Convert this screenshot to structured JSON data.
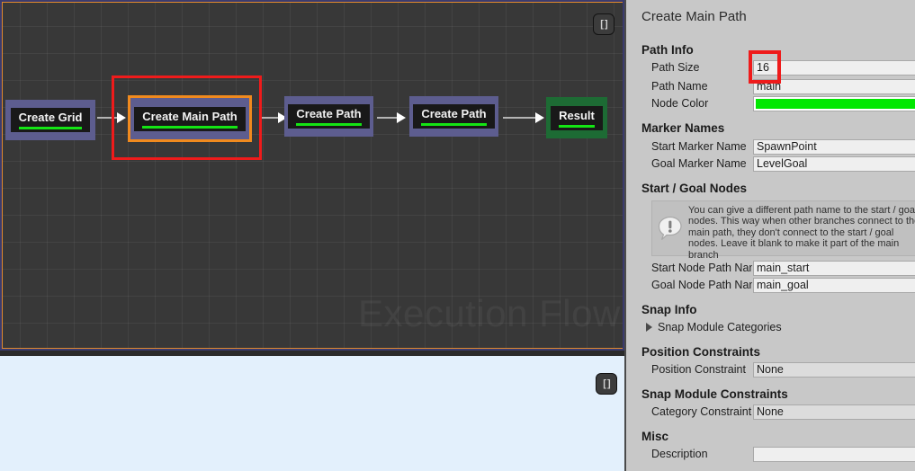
{
  "graph": {
    "watermark": "Execution Flow",
    "expand_button_icon": "brackets-icon",
    "nodes": [
      {
        "label": "Create Grid",
        "type": "node",
        "accent_color": "#14e514"
      },
      {
        "label": "Create Main Path",
        "type": "selected",
        "accent_color": "#14e514"
      },
      {
        "label": "Create Path",
        "type": "node",
        "accent_color": "#14e514"
      },
      {
        "label": "Create Path",
        "type": "node",
        "accent_color": "#14e514"
      },
      {
        "label": "Result",
        "type": "result",
        "accent_color": "#14e514"
      }
    ],
    "node_body_color": "#5d5d8f",
    "result_body_color": "#1d6b34",
    "selection_color": "#f08a1e",
    "annotation_color": "#ef1b1b"
  },
  "bottom_pane": {
    "expand_button_icon": "brackets-icon",
    "background_color": "#e3f0fc"
  },
  "inspector": {
    "title": "Create Main Path",
    "sections": {
      "path_info": {
        "heading": "Path Info",
        "rows": [
          {
            "label": "Path Size",
            "value": "16"
          },
          {
            "label": "Path Name",
            "value": "main"
          },
          {
            "label": "Node Color",
            "value": "#00e800"
          }
        ]
      },
      "marker_names": {
        "heading": "Marker Names",
        "rows": [
          {
            "label": "Start Marker Name",
            "value": "SpawnPoint"
          },
          {
            "label": "Goal Marker Name",
            "value": "LevelGoal"
          }
        ]
      },
      "start_goal_nodes": {
        "heading": "Start / Goal Nodes",
        "help_icon": "info-exclamation-icon",
        "help_text": "You can give a different path name to the start / goal nodes. This way when other branches connect to the main path, they don't connect to the start / goal nodes. Leave it blank to make it part of the main branch",
        "rows": [
          {
            "label": "Start Node Path Name",
            "value": "main_start"
          },
          {
            "label": "Goal Node Path Name",
            "value": "main_goal"
          }
        ]
      },
      "snap_info": {
        "heading": "Snap Info",
        "foldout_label": "Snap Module Categories",
        "foldout_icon": "chevron-right-icon"
      },
      "position_constraints": {
        "heading": "Position Constraints",
        "rows": [
          {
            "label": "Position Constraint",
            "value": "None"
          }
        ]
      },
      "snap_module_constraints": {
        "heading": "Snap Module Constraints",
        "rows": [
          {
            "label": "Category Constraint",
            "value": "None"
          }
        ]
      },
      "misc": {
        "heading": "Misc",
        "rows": [
          {
            "label": "Description",
            "value": ""
          }
        ]
      }
    }
  }
}
